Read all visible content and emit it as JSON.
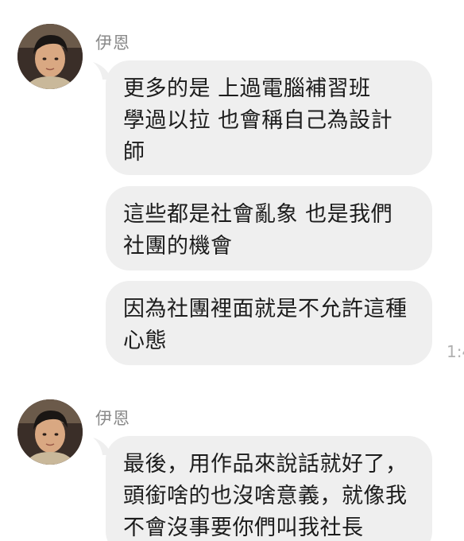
{
  "messages": [
    {
      "sender": "伊恩",
      "avatar_icon": "user-avatar-photo",
      "bubbles": [
        {
          "lines": [
            "更多的是  上過電腦補習班",
            "學過以拉  也會稱自己為設計",
            "師"
          ]
        },
        {
          "lines": [
            "這些都是社會亂象  也是我們",
            "社團的機會"
          ]
        },
        {
          "lines": [
            "因為社團裡面就是不允許這種",
            "心態"
          ]
        }
      ],
      "timestamp": "1:4"
    },
    {
      "sender": "伊恩",
      "avatar_icon": "user-avatar-photo",
      "bubbles": [
        {
          "lines": [
            "最後，用作品來說話就好了，",
            "頭銜啥的也沒啥意義，就像我",
            "不會沒事要你們叫我社長"
          ]
        }
      ]
    }
  ],
  "colors": {
    "bubble_bg": "#efefef",
    "text": "#1c1c1c",
    "sender_text": "#8a8a8a",
    "timestamp_text": "#b0b0b0"
  }
}
